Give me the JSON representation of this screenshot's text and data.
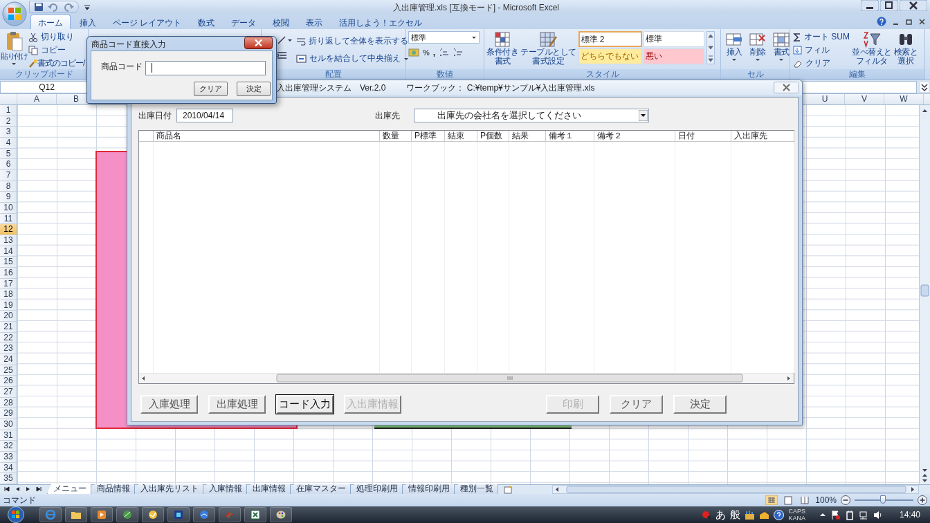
{
  "title_bar": {
    "title": "入出庫管理.xls  [互換モード] - Microsoft Excel"
  },
  "ribbon_tabs": [
    {
      "label": "ホーム",
      "selected": true
    },
    {
      "label": "挿入",
      "selected": false
    },
    {
      "label": "ページ レイアウト",
      "selected": false
    },
    {
      "label": "数式",
      "selected": false
    },
    {
      "label": "データ",
      "selected": false
    },
    {
      "label": "校閲",
      "selected": false
    },
    {
      "label": "表示",
      "selected": false
    },
    {
      "label": "活用しよう！エクセル",
      "selected": false
    }
  ],
  "ribbon": {
    "clipboard": {
      "paste": "貼り付け",
      "cut": "切り取り",
      "copy": "コピー",
      "format_painter": "書式のコピー/",
      "label": "クリップボード"
    },
    "alignment": {
      "wrap_text": "折り返して全体を表示する",
      "merge_center": "セルを結合して中央揃え",
      "label": "配置"
    },
    "number": {
      "format": "標準",
      "percent": "%",
      "comma": ",",
      "label": "数値"
    },
    "styles": {
      "conditional": [
        "条件付き",
        "書式"
      ],
      "table": [
        "テーブルとして",
        "書式設定"
      ],
      "gallery": [
        {
          "label": "標準 2",
          "color": "#ffffff",
          "selected": true
        },
        {
          "label": "標準",
          "color": "#ffffff",
          "selected": false
        },
        {
          "label": "どちらでもない",
          "color": "#ffeb9c",
          "selected": false
        },
        {
          "label": "悪い",
          "color": "#ffc7ce",
          "selected": false
        }
      ],
      "label": "スタイル"
    },
    "cells": {
      "insert": "挿入",
      "delete": "削除",
      "format": "書式",
      "label": "セル"
    },
    "editing": {
      "autosum": "オート SUM",
      "fill": "フィル",
      "clear": "クリア",
      "sort_filter": [
        "並べ替えと",
        "フィルタ"
      ],
      "find_select": [
        "検索と",
        "選択"
      ],
      "label": "編集"
    }
  },
  "formula_bar": {
    "name_box": "Q12"
  },
  "columns": {
    "left": [
      "A",
      "B"
    ],
    "right": [
      "U",
      "V",
      "W"
    ]
  },
  "rows": [
    {
      "label": "1",
      "selected": false
    },
    {
      "label": "2",
      "selected": false
    },
    {
      "label": "3",
      "selected": false
    },
    {
      "label": "4",
      "selected": false
    },
    {
      "label": "5",
      "selected": false
    },
    {
      "label": "6",
      "selected": false
    },
    {
      "label": "7",
      "selected": false
    },
    {
      "label": "8",
      "selected": false
    },
    {
      "label": "9",
      "selected": false
    },
    {
      "label": "10",
      "selected": false
    },
    {
      "label": "11",
      "selected": false
    },
    {
      "label": "12",
      "selected": true
    },
    {
      "label": "13",
      "selected": false
    },
    {
      "label": "14",
      "selected": false
    },
    {
      "label": "15",
      "selected": false
    },
    {
      "label": "16",
      "selected": false
    },
    {
      "label": "17",
      "selected": false
    },
    {
      "label": "18",
      "selected": false
    },
    {
      "label": "19",
      "selected": false
    },
    {
      "label": "20",
      "selected": false
    },
    {
      "label": "21",
      "selected": false
    },
    {
      "label": "22",
      "selected": false
    },
    {
      "label": "23",
      "selected": false
    },
    {
      "label": "24",
      "selected": false
    },
    {
      "label": "25",
      "selected": false
    },
    {
      "label": "26",
      "selected": false
    },
    {
      "label": "27",
      "selected": false
    },
    {
      "label": "28",
      "selected": false
    },
    {
      "label": "29",
      "selected": false
    },
    {
      "label": "30",
      "selected": false
    },
    {
      "label": "31",
      "selected": false
    },
    {
      "label": "32",
      "selected": false
    },
    {
      "label": "33",
      "selected": false
    },
    {
      "label": "34",
      "selected": false
    },
    {
      "label": "35",
      "selected": false
    }
  ],
  "sheet_tabs": [
    {
      "label": "メニュー",
      "selected": true
    },
    {
      "label": "商品情報",
      "selected": false
    },
    {
      "label": "入出庫先リスト",
      "selected": false
    },
    {
      "label": "入庫情報",
      "selected": false
    },
    {
      "label": "出庫情報",
      "selected": false
    },
    {
      "label": "在庫マスター",
      "selected": false
    },
    {
      "label": "処理印刷用",
      "selected": false
    },
    {
      "label": "情報印刷用",
      "selected": false
    },
    {
      "label": "種別一覧",
      "selected": false
    }
  ],
  "status_bar": {
    "mode": "コマンド",
    "zoom": "100%",
    "zoom_slider": {
      "level": 0.48
    }
  },
  "taskbar": {
    "ime_mode": "あ",
    "ime_kanji": "般",
    "caps": "CAPS",
    "kana": "KANA",
    "clock": "14:40"
  },
  "main_form": {
    "system_title": "入出庫管理システム　Ver.2.0",
    "workbook": "ワークブック： C:¥temp¥サンプル¥入出庫管理.xls",
    "date_label": "出庫日付",
    "date_value": "2010/04/14",
    "dest_label": "出庫先",
    "dest_value": "出庫先の会社名を選択してください",
    "list_columns": [
      "商品名",
      "数量",
      "P標準",
      "結束",
      "P個数",
      "結果",
      "備考１",
      "備考２",
      "日付",
      "入出庫先"
    ],
    "left_buttons": [
      {
        "label": "入庫処理",
        "disabled": false,
        "focused": false
      },
      {
        "label": "出庫処理",
        "disabled": false,
        "focused": false
      },
      {
        "label": "コード入力",
        "disabled": false,
        "focused": true
      },
      {
        "label": "入出庫情報",
        "disabled": true,
        "focused": false
      }
    ],
    "right_buttons": [
      {
        "label": "印刷",
        "disabled": true,
        "focused": false
      },
      {
        "label": "クリア",
        "disabled": false,
        "focused": false
      },
      {
        "label": "決定",
        "disabled": false,
        "focused": false
      }
    ]
  },
  "code_dialog": {
    "title": "商品コード直接入力",
    "field_label": "商品コード",
    "buttons": [
      "クリア",
      "決定"
    ]
  }
}
